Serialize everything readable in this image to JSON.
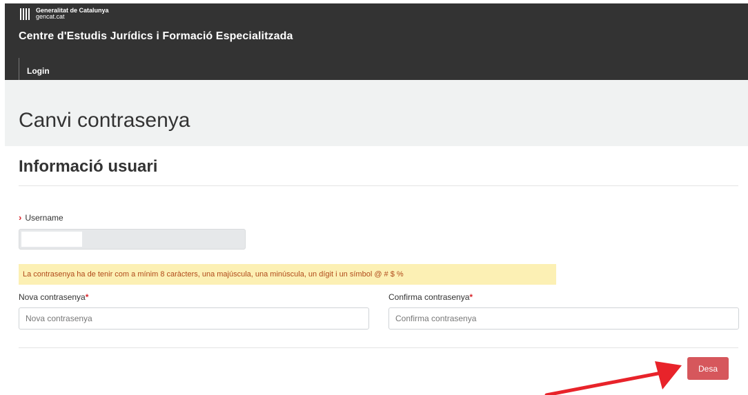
{
  "header": {
    "brand_line1": "Generalitat de Catalunya",
    "brand_line2": "gencat.cat",
    "site_title": "Centre d'Estudis Jurídics i Formació Especialitzada"
  },
  "nav": {
    "items": [
      {
        "label": "Login"
      }
    ]
  },
  "page": {
    "title": "Canvi contrasenya"
  },
  "section": {
    "title": "Informació usuari"
  },
  "username": {
    "label": "Username",
    "value": ""
  },
  "alert": {
    "text": "La contrasenya ha de tenir com a mínim 8 caràcters, una majúscula, una minúscula, un dígit i un símbol @ # $ %"
  },
  "new_password": {
    "label": "Nova contrasenya",
    "required_mark": "*",
    "placeholder": "Nova contrasenya",
    "value": ""
  },
  "confirm_password": {
    "label": "Confirma contrasenya",
    "required_mark": "*",
    "placeholder": "Confirma contrasenya",
    "value": ""
  },
  "actions": {
    "save_label": "Desa"
  },
  "colors": {
    "header_bg": "#333333",
    "title_bg": "#f0f2f2",
    "alert_bg": "#fcf0b4",
    "alert_text": "#b04a1a",
    "required": "#d9262c",
    "save_button": "#d6575c",
    "annotation_arrow": "#e8232a"
  },
  "icons": {
    "brand_logo": "generalitat-logo-icon",
    "username_marker": "chevron-right-icon",
    "annotation": "arrow-icon"
  }
}
